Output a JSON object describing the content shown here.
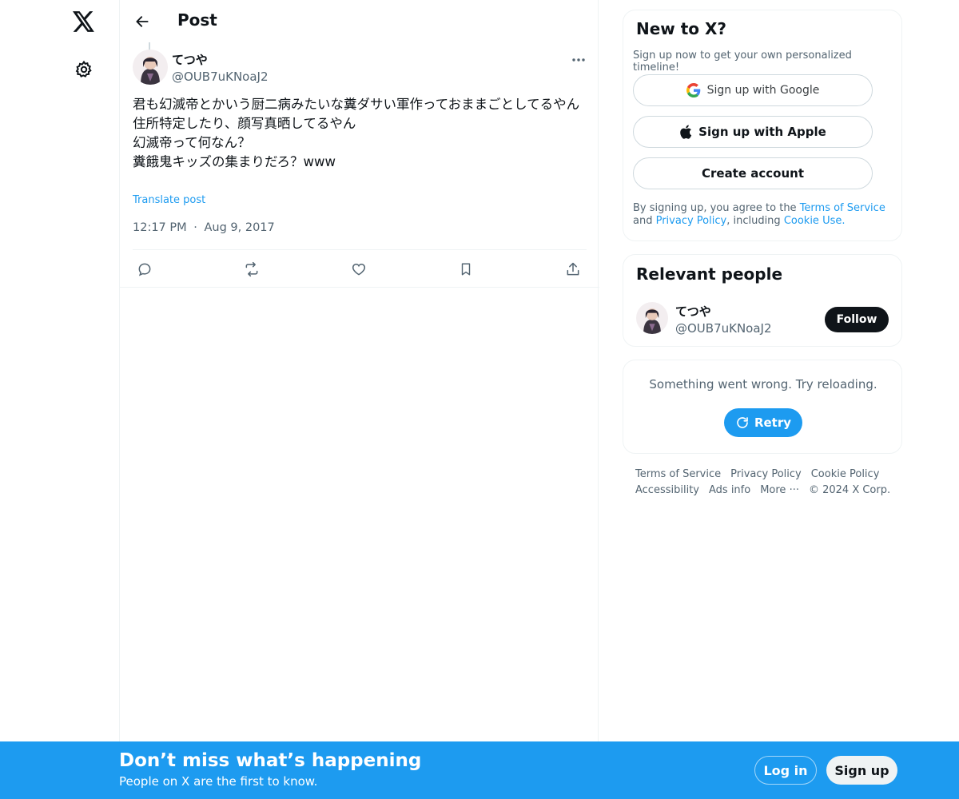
{
  "nav": {
    "logo_icon": "x-logo-icon",
    "settings_icon": "gear-icon"
  },
  "header": {
    "back_icon": "arrow-left-icon",
    "title": "Post"
  },
  "post": {
    "author_name": "てつや",
    "author_handle": "@OUB7uKNoaJ2",
    "more_icon": "more-horizontal-icon",
    "text_lines": [
      "君も幻滅帝とかいう厨二病みたいな糞ダサい軍作っておままごとしてるやん",
      "住所特定したり、顔写真晒してるやん",
      "幻滅帝って何なん？",
      "糞餓鬼キッズの集まりだろ？www"
    ],
    "translate_label": "Translate post",
    "time": "12:17 PM",
    "separator": "·",
    "date": "Aug 9, 2017",
    "actions": [
      "reply-icon",
      "repost-icon",
      "like-icon",
      "bookmark-icon",
      "share-icon"
    ]
  },
  "signup_card": {
    "title": "New to X?",
    "subtitle": "Sign up now to get your own personalized timeline!",
    "google_label": "Sign up with Google",
    "apple_label": "Sign up with Apple",
    "create_label": "Create account",
    "legal_prefix": "By signing up, you agree to the ",
    "terms_link": "Terms of Service",
    "legal_and": " and ",
    "privacy_link": "Privacy Policy",
    "legal_including": ", including ",
    "cookie_link": "Cookie Use."
  },
  "relevant_people": {
    "title": "Relevant people",
    "name": "てつや",
    "handle": "@OUB7uKNoaJ2",
    "follow_label": "Follow"
  },
  "error_card": {
    "message": "Something went wrong. Try reloading.",
    "retry_label": "Retry"
  },
  "footer": {
    "links": [
      "Terms of Service",
      "Privacy Policy",
      "Cookie Policy",
      "Accessibility",
      "Ads info",
      "More ···",
      "© 2024 X Corp."
    ]
  },
  "banner": {
    "title": "Don’t miss what’s happening",
    "subtitle": "People on X are the first to know.",
    "login_label": "Log in",
    "signup_label": "Sign up"
  },
  "colors": {
    "accent": "#1d9bf0",
    "text": "#0f1419",
    "muted": "#536471",
    "border": "#eff3f4"
  }
}
